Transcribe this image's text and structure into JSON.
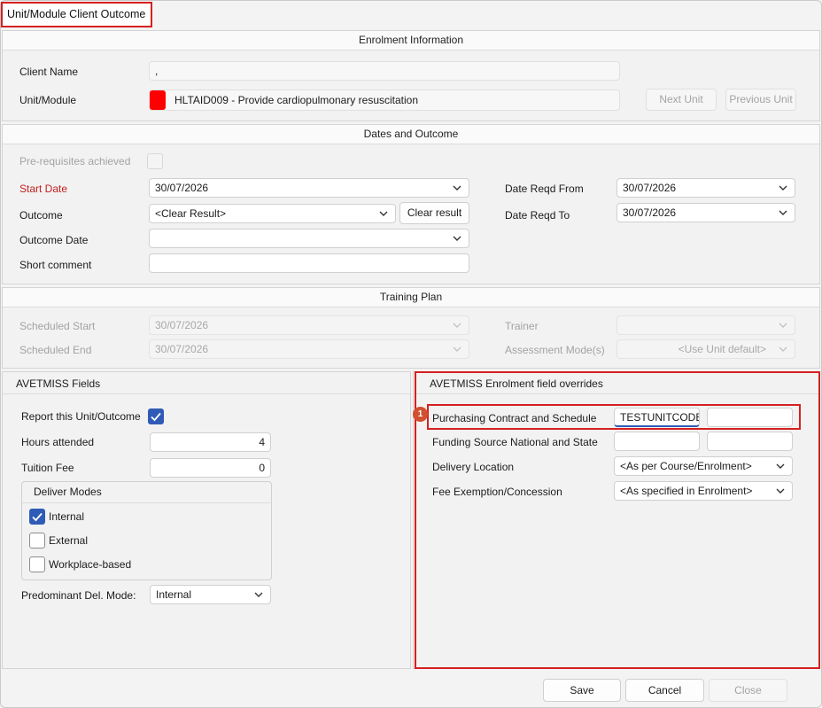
{
  "window": {
    "title": "Unit/Module Client Outcome"
  },
  "enrolment": {
    "header": "Enrolment Information",
    "client_name_label": "Client Name",
    "client_name_value": ",",
    "unit_label": "Unit/Module",
    "unit_value": "HLTAID009 - Provide cardiopulmonary resuscitation",
    "unit_color": "#ff0000",
    "next_unit": "Next Unit",
    "previous_unit": "Previous Unit"
  },
  "dates": {
    "header": "Dates and Outcome",
    "prereq_label": "Pre-requisites achieved",
    "start_date_label": "Start Date",
    "start_date_value": "30/07/2026",
    "outcome_label": "Outcome",
    "outcome_value": "<Clear Result>",
    "clear_result": "Clear result",
    "outcome_date_label": "Outcome Date",
    "outcome_date_value": "",
    "short_comment_label": "Short comment",
    "short_comment_value": "",
    "reqd_from_label": "Date Reqd From",
    "reqd_from_value": "30/07/2026",
    "reqd_to_label": "Date Reqd To",
    "reqd_to_value": "30/07/2026"
  },
  "training": {
    "header": "Training Plan",
    "scheduled_start_label": "Scheduled Start",
    "scheduled_start_value": "30/07/2026",
    "scheduled_end_label": "Scheduled End",
    "scheduled_end_value": "30/07/2026",
    "trainer_label": "Trainer",
    "trainer_value": "",
    "assessment_label": "Assessment Mode(s)",
    "assessment_value": "<Use Unit default>"
  },
  "avetmiss": {
    "header": "AVETMISS Fields",
    "report_label": "Report this Unit/Outcome",
    "report_checked": true,
    "hours_label": "Hours attended",
    "hours_value": "4",
    "tuition_label": "Tuition Fee",
    "tuition_value": "0",
    "deliver_modes_header": "Deliver Modes",
    "modes": [
      {
        "label": "Internal",
        "checked": true
      },
      {
        "label": "External",
        "checked": false
      },
      {
        "label": "Workplace-based",
        "checked": false
      }
    ],
    "predominant_label": "Predominant Del. Mode:",
    "predominant_value": "Internal"
  },
  "overrides": {
    "header": "AVETMISS Enrolment field overrides",
    "badge": "1",
    "purchasing_label": "Purchasing Contract and Schedule",
    "purchasing_value1": "TESTUNITCODE",
    "purchasing_value2": "",
    "funding_label": "Funding Source National and State",
    "funding_value1": "",
    "funding_value2": "",
    "delivery_label": "Delivery Location",
    "delivery_value": "<As per Course/Enrolment>",
    "fee_label": "Fee Exemption/Concession",
    "fee_value": "<As specified in Enrolment>"
  },
  "footer": {
    "save": "Save",
    "cancel": "Cancel",
    "close": "Close"
  },
  "colors": {
    "highlight": "#d62020",
    "accent": "#2f5bb7",
    "badge": "#d0502f"
  }
}
